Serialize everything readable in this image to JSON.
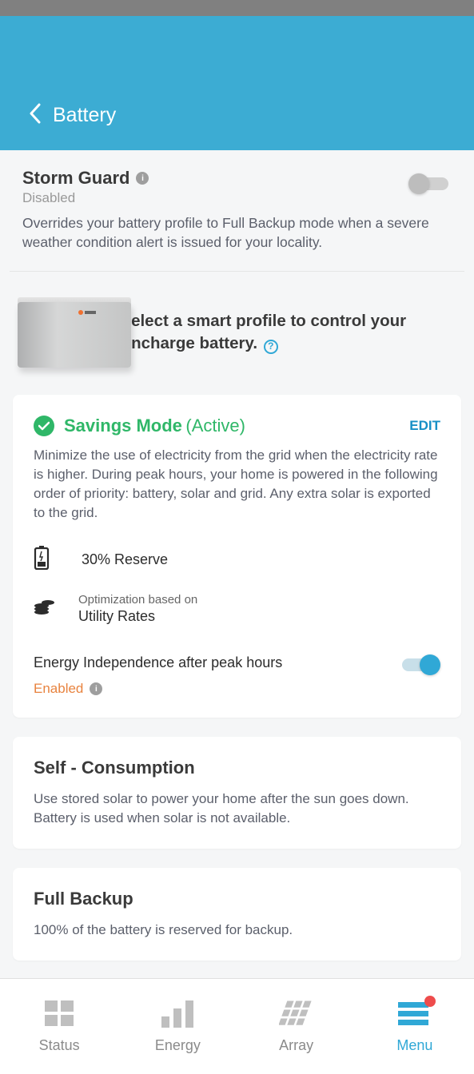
{
  "header": {
    "title": "Battery"
  },
  "storm_guard": {
    "title": "Storm Guard",
    "status": "Disabled",
    "description": "Overrides your battery profile to Full Backup mode when a severe weather condition alert is issued for your locality.",
    "enabled": false
  },
  "profile_intro": "Select a smart profile to control your Encharge battery.",
  "savings": {
    "title": "Savings Mode",
    "active_suffix": "(Active)",
    "edit": "EDIT",
    "description": "Minimize the use of electricity from the grid when the electricity rate is higher. During peak hours, your home is powered in the following order of priority: battery, solar and grid. Any extra solar is exported to the grid.",
    "reserve": "30% Reserve",
    "optimization_label": "Optimization based on",
    "optimization_value": "Utility Rates",
    "energy_independence_label": "Energy Independence after peak hours",
    "energy_independence_status": "Enabled",
    "energy_independence_on": true
  },
  "self_consumption": {
    "title": "Self - Consumption",
    "description": "Use stored solar to power your home after the sun goes down. Battery is used when solar is not available."
  },
  "full_backup": {
    "title": "Full Backup",
    "description": "100% of the battery is reserved for backup."
  },
  "nav": {
    "status": "Status",
    "energy": "Energy",
    "array": "Array",
    "menu": "Menu"
  }
}
